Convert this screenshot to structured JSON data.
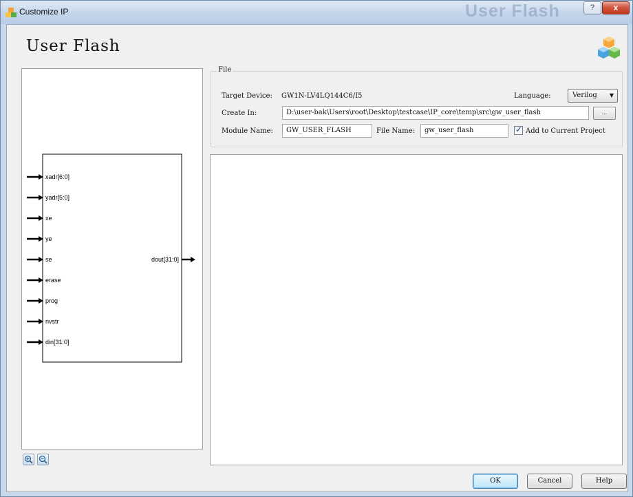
{
  "window": {
    "title": "Customize IP",
    "watermark": "User Flash",
    "help_glyph": "?",
    "close_glyph": "x"
  },
  "page": {
    "title": "User Flash"
  },
  "schematic": {
    "inputs": [
      "xadr[6:0]",
      "yadr[5:0]",
      "xe",
      "ye",
      "se",
      "erase",
      "prog",
      "nvstr",
      "din[31:0]"
    ],
    "outputs": [
      "dout[31:0]"
    ]
  },
  "file_group": {
    "legend": "File",
    "target_device_label": "Target Device:",
    "target_device_value": "GW1N-LV4LQ144C6/I5",
    "language_label": "Language:",
    "language_value": "Verilog",
    "create_in_label": "Create In:",
    "create_in_value": "D:\\user-bak\\Users\\root\\Desktop\\testcase\\IP_core\\temp\\src\\gw_user_flash",
    "browse_label": "...",
    "module_name_label": "Module Name:",
    "module_name_value": "GW_USER_FLASH",
    "file_name_label": "File Name:",
    "file_name_value": "gw_user_flash",
    "add_to_project_label": "Add to Current Project",
    "add_to_project_checked": true
  },
  "buttons": {
    "ok": "OK",
    "cancel": "Cancel",
    "help": "Help"
  },
  "colors": {
    "titlebar": "#c6d7ec",
    "close": "#c2391f",
    "default_button": "#bee6fd"
  }
}
